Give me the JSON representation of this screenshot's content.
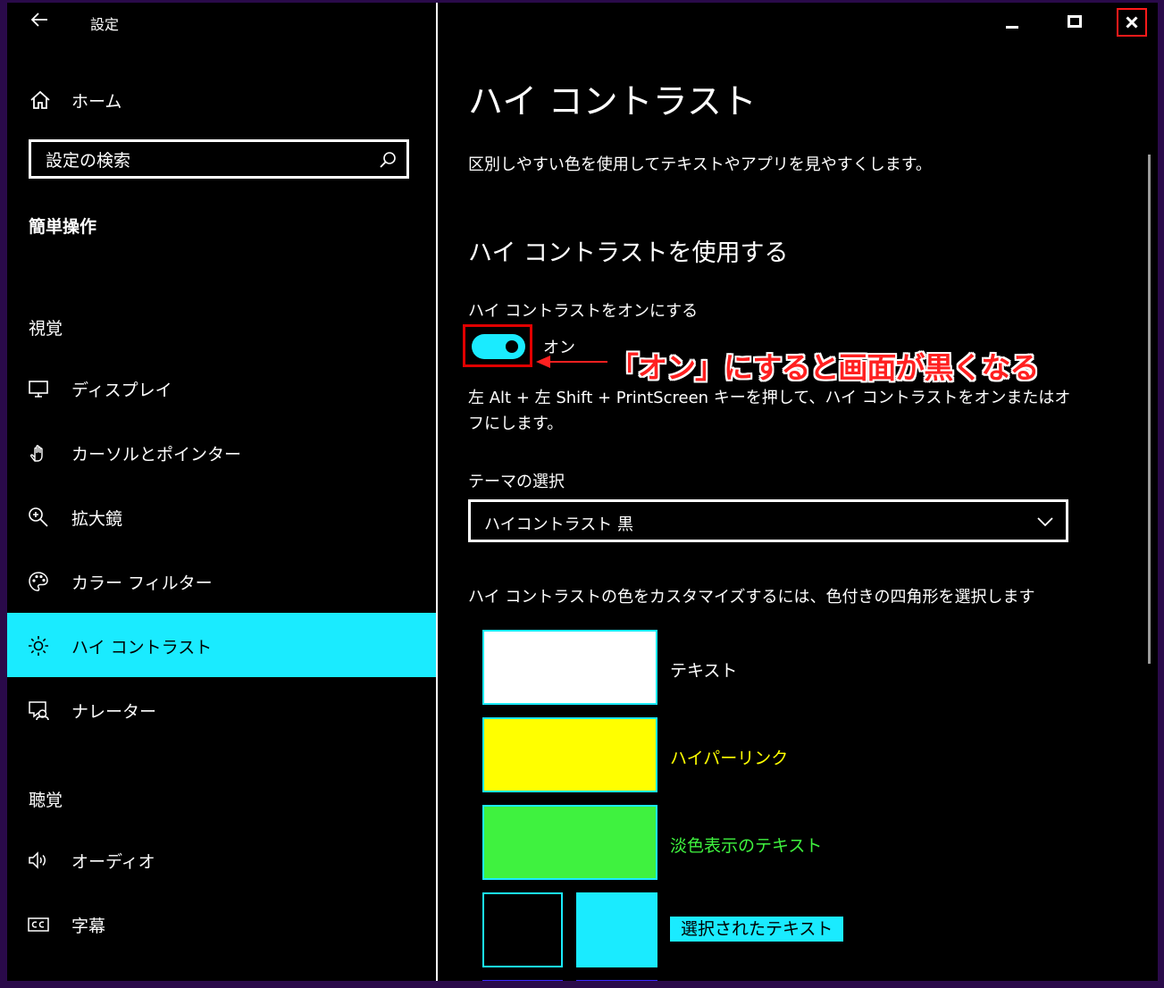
{
  "window": {
    "title": "設定"
  },
  "sidebar": {
    "home_label": "ホーム",
    "search_placeholder": "設定の検索",
    "section_title": "簡単操作",
    "group_vision": "視覚",
    "vision_items": [
      {
        "label": "ディスプレイ",
        "icon": "monitor-icon"
      },
      {
        "label": "カーソルとポインター",
        "icon": "pointer-icon"
      },
      {
        "label": "拡大鏡",
        "icon": "magnifier-icon"
      },
      {
        "label": "カラー フィルター",
        "icon": "palette-icon"
      },
      {
        "label": "ハイ コントラスト",
        "icon": "brightness-icon",
        "active": true
      },
      {
        "label": "ナレーター",
        "icon": "narrator-icon"
      }
    ],
    "group_hearing": "聴覚",
    "hearing_items": [
      {
        "label": "オーディオ",
        "icon": "speaker-icon"
      },
      {
        "label": "字幕",
        "icon": "captions-icon"
      }
    ]
  },
  "main": {
    "title": "ハイ コントラスト",
    "description": "区別しやすい色を使用してテキストやアプリを見やすくします。",
    "use_heading": "ハイ コントラストを使用する",
    "toggle_label": "ハイ コントラストをオンにする",
    "toggle_state": "オン",
    "toggle_on": true,
    "annotation": "「オン」にすると画面が黒くなる",
    "shortcut_desc": "左 Alt + 左 Shift + PrintScreen キーを押して、ハイ コントラストをオンまたはオフにします。",
    "theme_label": "テーマの選択",
    "theme_value": "ハイコントラスト 黒",
    "customize_desc": "ハイ コントラストの色をカスタマイズするには、色付きの四角形を選択します",
    "swatches": {
      "text": {
        "label": "テキスト",
        "color": "#ffffff"
      },
      "hyperlink": {
        "label": "ハイパーリンク",
        "color": "#ffff00"
      },
      "disabled": {
        "label": "淡色表示のテキスト",
        "color": "#3ff23f"
      },
      "selected": {
        "label": "選択されたテキスト",
        "fg": "#000000",
        "bg": "#1aebff"
      }
    }
  },
  "colors": {
    "accent": "#1aebff",
    "annotation_red": "#ff2020",
    "border_purple": "#2a0a4a"
  }
}
